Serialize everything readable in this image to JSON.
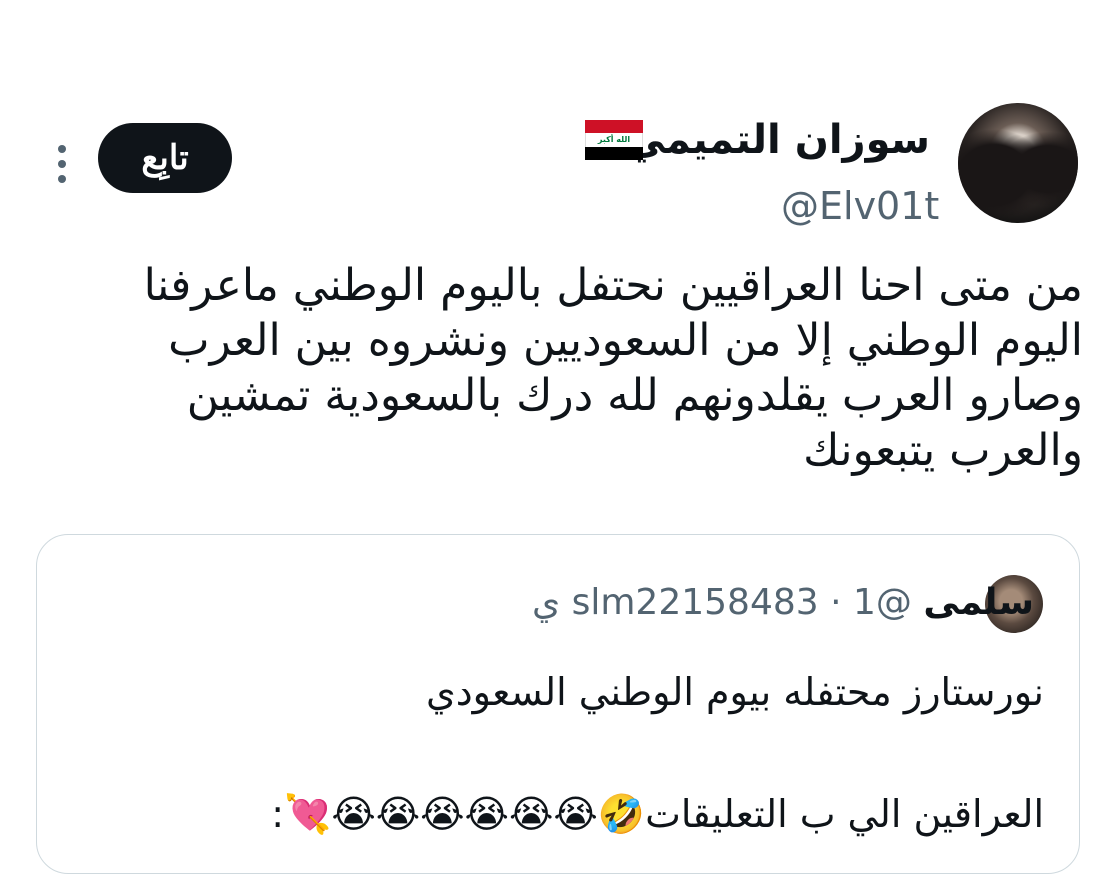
{
  "author": {
    "display_name": "سوزان التميمي",
    "flag_label": "الله أكبر",
    "handle": "@Elv01t",
    "follow_label": "تابِع",
    "flag_icon": "iraq-flag-icon",
    "more_icon": "more-vertical-icon"
  },
  "tweet": {
    "lines": [
      "من متى احنا العراقيين نحتفل باليوم الوطني ماعرفنا",
      "اليوم الوطني إلا من السعوديين ونشروه بين العرب",
      "وصارو العرب يقلدونهم لله درك بالسعودية تمشين",
      "والعرب يتبعونك"
    ]
  },
  "quote": {
    "name": "سلمى",
    "handle_time": "@slm22158483 · 1 ي",
    "line1": "نورستارز محتفله بيوم الوطني السعودي",
    "line2": "العراقين الي ب التعليقات🤣😭😭😭😭😭😭💘:"
  },
  "colors": {
    "text": "#0f1419",
    "secondary": "#536471",
    "border": "#cfd9de",
    "follow_bg": "#0f1419"
  }
}
